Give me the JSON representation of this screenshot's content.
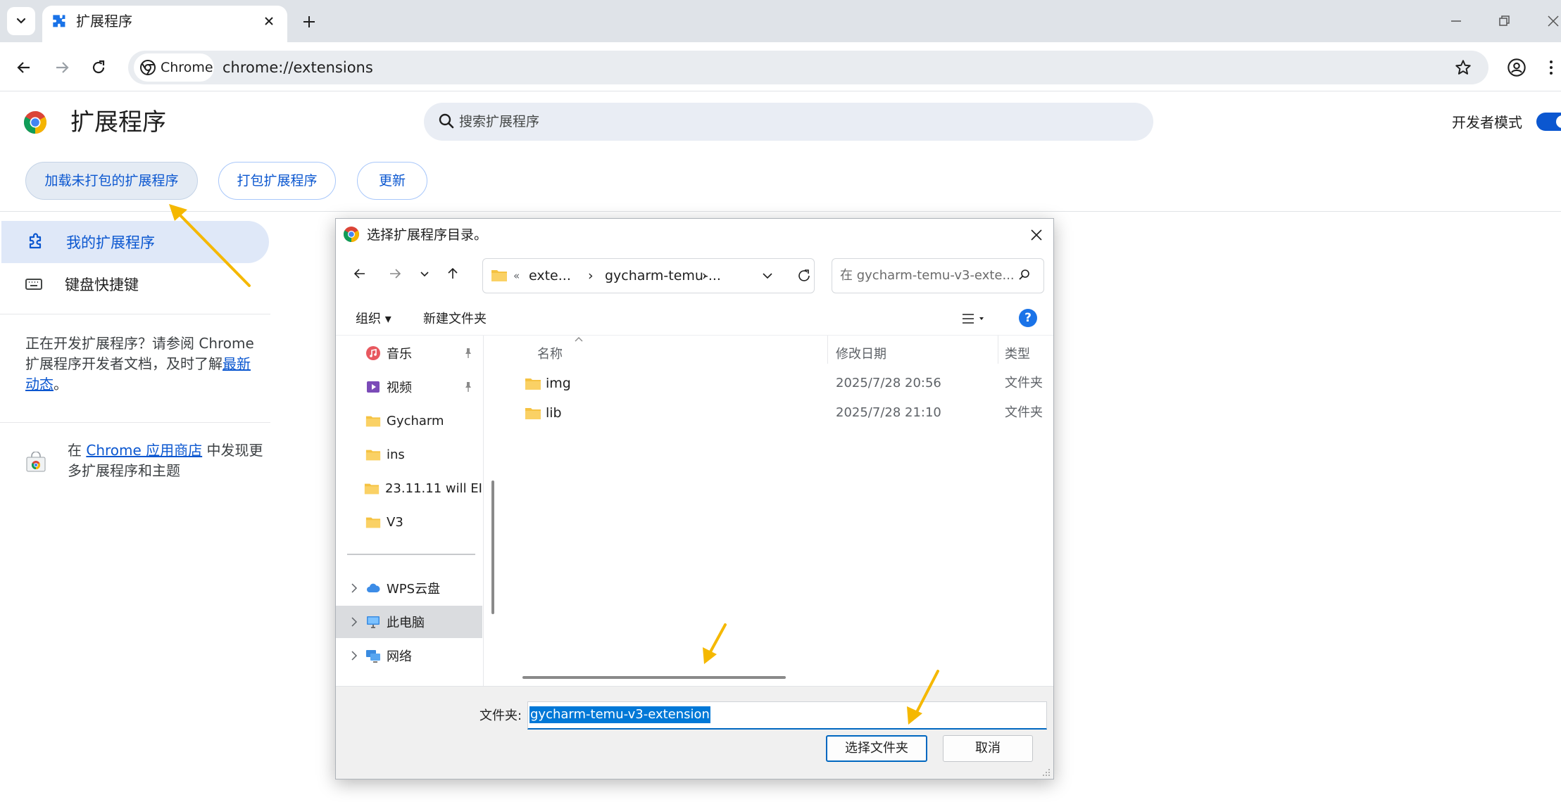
{
  "browser": {
    "tab_title": "扩展程序",
    "site_chip": "Chrome",
    "url": "chrome://extensions"
  },
  "page": {
    "title": "扩展程序",
    "search_placeholder": "搜索扩展程序",
    "dev_mode_label": "开发者模式",
    "dev_mode_on": true,
    "buttons": {
      "load_unpacked": "加载未打包的扩展程序",
      "pack": "打包扩展程序",
      "update": "更新"
    },
    "sidebar": {
      "my_extensions": "我的扩展程序",
      "shortcuts": "键盘快捷键",
      "dev_note_before": "正在开发扩展程序？请参阅 Chrome 扩展程序开发者文档，及时了解",
      "dev_note_link": "最新动态",
      "dev_note_after": "。",
      "store_before": "在 ",
      "store_link": "Chrome 应用商店",
      "store_after": " 中发现更多扩展程序和主题"
    }
  },
  "dialog": {
    "title": "选择扩展程序目录。",
    "address": {
      "prefix": "«",
      "part1": "exte...",
      "sep": "›",
      "part2": "gycharm-temu-..."
    },
    "search_placeholder": "在 gycharm-temu-v3-exte...",
    "commands": {
      "organize": "组织 ▾",
      "new_folder": "新建文件夹"
    },
    "tree": [
      {
        "label": "音乐",
        "icon": "music-icon",
        "pinned": true
      },
      {
        "label": "视频",
        "icon": "video-icon",
        "pinned": true
      },
      {
        "label": "Gycharm",
        "icon": "folder-icon",
        "pinned": false
      },
      {
        "label": "ins",
        "icon": "folder-icon",
        "pinned": false
      },
      {
        "label": "23.11.11 will EI",
        "icon": "folder-icon",
        "pinned": false
      },
      {
        "label": "V3",
        "icon": "folder-icon",
        "pinned": false
      },
      {
        "label": "WPS云盘",
        "icon": "cloud-icon",
        "pinned": false
      },
      {
        "label": "此电脑",
        "icon": "computer-icon",
        "pinned": false
      },
      {
        "label": "网络",
        "icon": "network-icon",
        "pinned": false
      }
    ],
    "columns": {
      "name": "名称",
      "date": "修改日期",
      "type": "类型"
    },
    "files": [
      {
        "name": "img",
        "date": "2025/7/28 20:56",
        "type": "文件夹"
      },
      {
        "name": "lib",
        "date": "2025/7/28 21:10",
        "type": "文件夹"
      }
    ],
    "folder_label": "文件夹:",
    "folder_value": "gycharm-temu-v3-extension",
    "select_button": "选择文件夹",
    "cancel_button": "取消"
  },
  "colors": {
    "accent": "#0b57d0",
    "annotation_arrow": "#f5b800",
    "selection": "#0078d7"
  }
}
